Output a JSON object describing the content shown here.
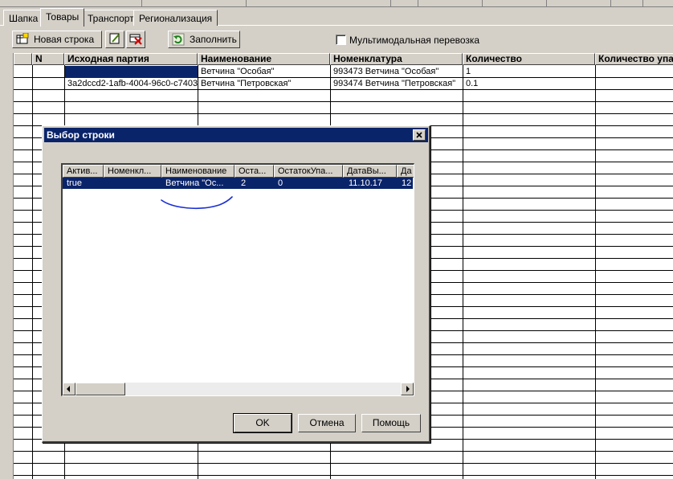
{
  "tabs": [
    {
      "label": "Шапка"
    },
    {
      "label": "Товары"
    },
    {
      "label": "Транспорт"
    },
    {
      "label": "Регионализация"
    }
  ],
  "toolbar": {
    "new_row_label": "Новая строка",
    "fill_label": "Заполнить",
    "multimodal_label": "Мультимодальная перевозка",
    "multimodal_checked": false
  },
  "grid": {
    "columns": [
      "",
      "N",
      "Исходная партия",
      "Наименование",
      "Номенклатура",
      "Количество",
      "Количество упак"
    ],
    "rows": [
      {
        "n": "",
        "batch": "",
        "name": "Ветчина \"Особая\"",
        "nomenclature": "993473 Ветчина \"Особая\"",
        "qty": "1",
        "qty_pack": ""
      },
      {
        "n": "",
        "batch": "3a2dccd2-1afb-4004-96c0-c7403",
        "name": "Ветчина \"Петровская\"",
        "nomenclature": "993474 Ветчина \"Петровская\"",
        "qty": "0.1",
        "qty_pack": ""
      }
    ]
  },
  "dialog": {
    "title": "Выбор строки",
    "columns": [
      "Актив...",
      "Номенкл...",
      "Наименование",
      "Оста...",
      "ОстатокУпа...",
      "ДатаВы...",
      "Да"
    ],
    "rows": [
      {
        "active": "true",
        "nomenclature": "",
        "name": "Ветчина \"Ос...",
        "rest": "2",
        "rest_pack": "0",
        "date": "11.10.17",
        "extra": "12"
      }
    ],
    "ok_label": "OK",
    "cancel_label": "Отмена",
    "help_label": "Помощь"
  },
  "colors": {
    "face": "#d4d0c8",
    "selection": "#0a246a",
    "title_bar": "#0a246a",
    "annotation_stroke": "#1a2fd6"
  }
}
